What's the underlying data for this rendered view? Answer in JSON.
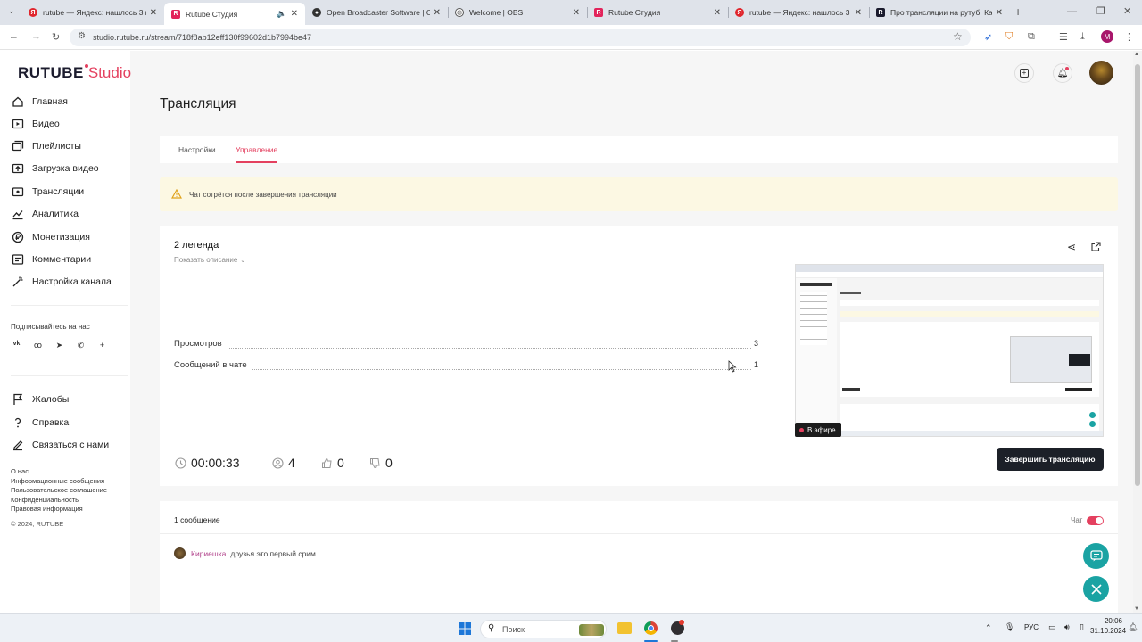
{
  "browser": {
    "tabs": [
      {
        "label": "rutube — Яндекс: нашлось 3 м",
        "icon": "yandex-icon",
        "color": "#e0262d",
        "active": false
      },
      {
        "label": "Rutube Студия",
        "icon": "rutube-icon",
        "color": "#e2245b",
        "active": true
      },
      {
        "label": "Open Broadcaster Software | O",
        "icon": "obs-icon",
        "color": "#333333",
        "active": false
      },
      {
        "label": "Welcome | OBS",
        "icon": "globe-icon",
        "color": "#555555",
        "active": false
      },
      {
        "label": "Rutube Студия",
        "icon": "rutube-icon",
        "color": "#e2245b",
        "active": false
      },
      {
        "label": "rutube — Яндекс: нашлось 3 м",
        "icon": "yandex-icon",
        "color": "#e0262d",
        "active": false
      },
      {
        "label": "Про трансляции на рутуб. Ка",
        "icon": "rutube-icon",
        "color": "#1b1b2d",
        "active": false
      }
    ],
    "url": "studio.rutube.ru/stream/718f8ab12eff130f99602d1b7994be47",
    "profile_letter": "M"
  },
  "app": {
    "logo_main": "RUTUBE",
    "logo_sub": "Studio",
    "accent": "#e4405f"
  },
  "sidebar": {
    "items": [
      {
        "label": "Главная",
        "icon": "home-icon"
      },
      {
        "label": "Видео",
        "icon": "video-icon"
      },
      {
        "label": "Плейлисты",
        "icon": "playlist-icon"
      },
      {
        "label": "Загрузка видео",
        "icon": "upload-icon"
      },
      {
        "label": "Трансляции",
        "icon": "broadcast-icon"
      },
      {
        "label": "Аналитика",
        "icon": "analytics-icon"
      },
      {
        "label": "Монетизация",
        "icon": "monetization-icon"
      },
      {
        "label": "Комментарии",
        "icon": "comments-icon"
      },
      {
        "label": "Настройка канала",
        "icon": "settings-wand-icon"
      }
    ],
    "subscribe_label": "Подписывайтесь на нас",
    "socials": [
      "vk-icon",
      "ok-icon",
      "telegram-icon",
      "viber-icon",
      "plus-icon"
    ],
    "help_items": [
      {
        "label": "Жалобы",
        "icon": "flag-icon"
      },
      {
        "label": "Справка",
        "icon": "help-icon"
      },
      {
        "label": "Связаться с нами",
        "icon": "edit-icon"
      }
    ],
    "footer_links": [
      "О нас",
      "Информационные сообщения",
      "Пользовательское соглашение",
      "Конфиденциальность",
      "Правовая информация"
    ],
    "copyright": "© 2024, RUTUBE"
  },
  "page": {
    "title": "Трансляция",
    "tabs": [
      {
        "label": "Настройки",
        "active": false
      },
      {
        "label": "Управление",
        "active": true
      }
    ],
    "warning": "Чат сотрётся после завершения трансляции"
  },
  "stream": {
    "name": "2 легенда",
    "show_description": "Показать описание",
    "stats": [
      {
        "label": "Просмотров",
        "value": "3"
      },
      {
        "label": "Сообщений в чате",
        "value": "1"
      }
    ],
    "duration": "00:00:33",
    "viewers": "4",
    "likes": "0",
    "dislikes": "0",
    "live_badge": "В эфире",
    "end_button": "Завершить трансляцию"
  },
  "chat": {
    "count_label": "1 сообщение",
    "toggle_label": "Чат",
    "toggle_on": true,
    "messages": [
      {
        "author": "Кириешка",
        "text": "друзья это первый срим"
      }
    ]
  },
  "taskbar": {
    "search_placeholder": "Поиск",
    "lang": "РУС",
    "time": "20:06",
    "date": "31.10.2024"
  }
}
